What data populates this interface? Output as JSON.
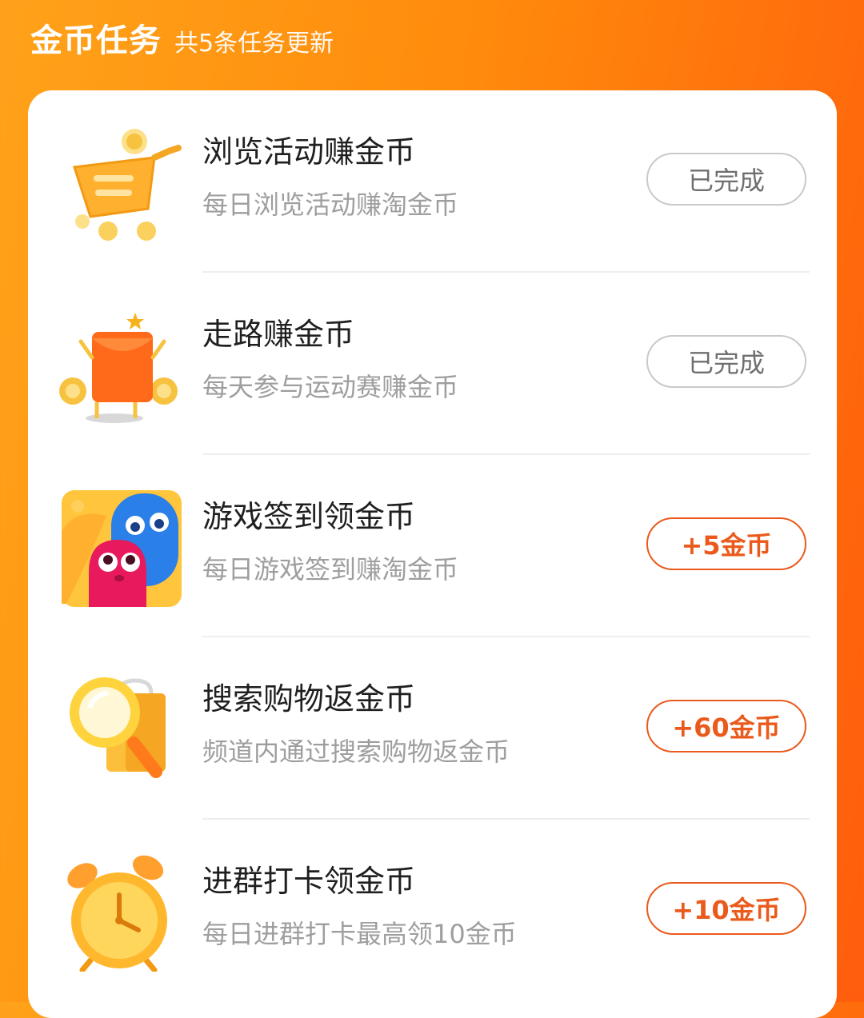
{
  "header": {
    "title": "金币任务",
    "subtitle": "共5条任务更新"
  },
  "tasks": [
    {
      "title": "浏览活动赚金币",
      "desc": "每日浏览活动赚淘金币",
      "button": "已完成",
      "icon": "shopping-cart-icon"
    },
    {
      "title": "走路赚金币",
      "desc": "每天参与运动赛赚金币",
      "button": "已完成",
      "icon": "red-envelope-icon"
    },
    {
      "title": "游戏签到领金币",
      "desc": "每日游戏签到赚淘金币",
      "button": "+5金币",
      "icon": "game-characters-icon"
    },
    {
      "title": "搜索购物返金币",
      "desc": "频道内通过搜索购物返金币",
      "button": "+60金币",
      "icon": "magnifier-bag-icon"
    },
    {
      "title": "进群打卡领金币",
      "desc": "每日进群打卡最高领10金币",
      "button": "+10金币",
      "icon": "alarm-clock-icon"
    }
  ],
  "colors": {
    "accent": "#ea5a1c",
    "header_gradient_start": "#ffa21a",
    "header_gradient_end": "#ff5d0c",
    "done_border": "#c9c9c9"
  }
}
